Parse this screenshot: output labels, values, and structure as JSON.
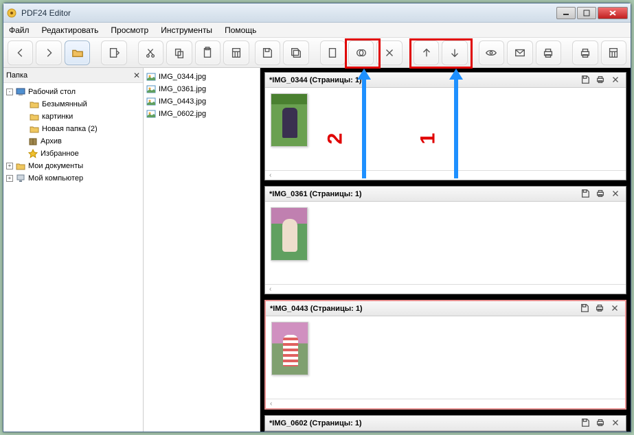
{
  "window": {
    "title": "PDF24 Editor"
  },
  "menu": {
    "file": "Файл",
    "edit": "Редактировать",
    "view": "Просмотр",
    "tools": "Инструменты",
    "help": "Помощь"
  },
  "left_panel": {
    "title": "Папка"
  },
  "tree": {
    "desktop": "Рабочий стол",
    "untitled": "Безымянный",
    "pictures": "картинки",
    "newfolder": "Новая папка (2)",
    "archive": "Архив",
    "favorites": "Избранное",
    "mydocs": "Мои документы",
    "mycomputer": "Мой компьютер"
  },
  "files": [
    {
      "name": "IMG_0344.jpg"
    },
    {
      "name": "IMG_0361.jpg"
    },
    {
      "name": "IMG_0443.jpg"
    },
    {
      "name": "IMG_0602.jpg"
    }
  ],
  "docs": [
    {
      "title": "*IMG_0344 (Страницы: 1)"
    },
    {
      "title": "*IMG_0361 (Страницы: 1)"
    },
    {
      "title": "*IMG_0443 (Страницы: 1)"
    },
    {
      "title": "*IMG_0602 (Страницы: 1)"
    }
  ],
  "annotations": {
    "label1": "1",
    "label2": "2"
  }
}
